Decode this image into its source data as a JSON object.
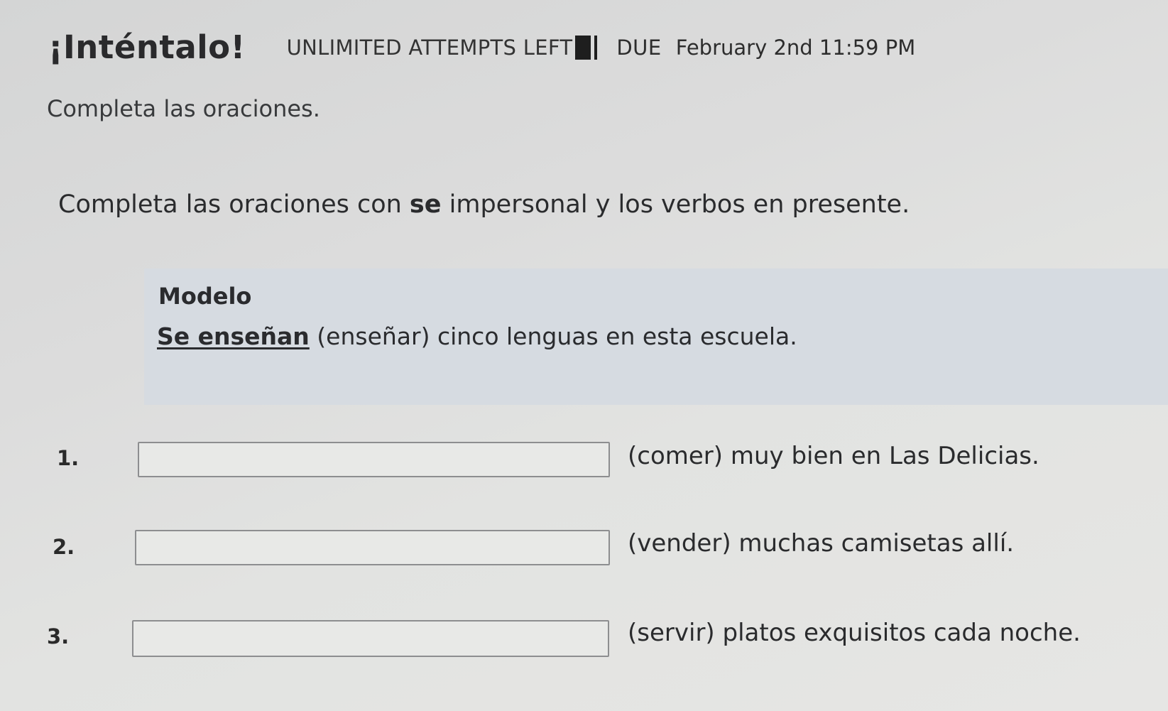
{
  "header": {
    "title": "¡Inténtalo!",
    "attempts": "UNLIMITED ATTEMPTS LEFT",
    "due_label": "DUE",
    "due_date": "February 2nd 11:59 PM"
  },
  "subtitle": "Completa las oraciones.",
  "instructions": {
    "before": "Completa las oraciones con ",
    "bold": "se",
    "after": " impersonal y los verbos en presente."
  },
  "modelo": {
    "title": "Modelo",
    "answer": "Se enseñan",
    "rest": " (enseñar) cinco lenguas en esta escuela."
  },
  "items": [
    {
      "number": "1.",
      "value": "",
      "text": "(comer) muy bien en Las Delicias."
    },
    {
      "number": "2.",
      "value": "",
      "text": "(vender) muchas camisetas allí."
    },
    {
      "number": "3.",
      "value": "",
      "text": "(servir) platos exquisitos cada noche."
    }
  ]
}
